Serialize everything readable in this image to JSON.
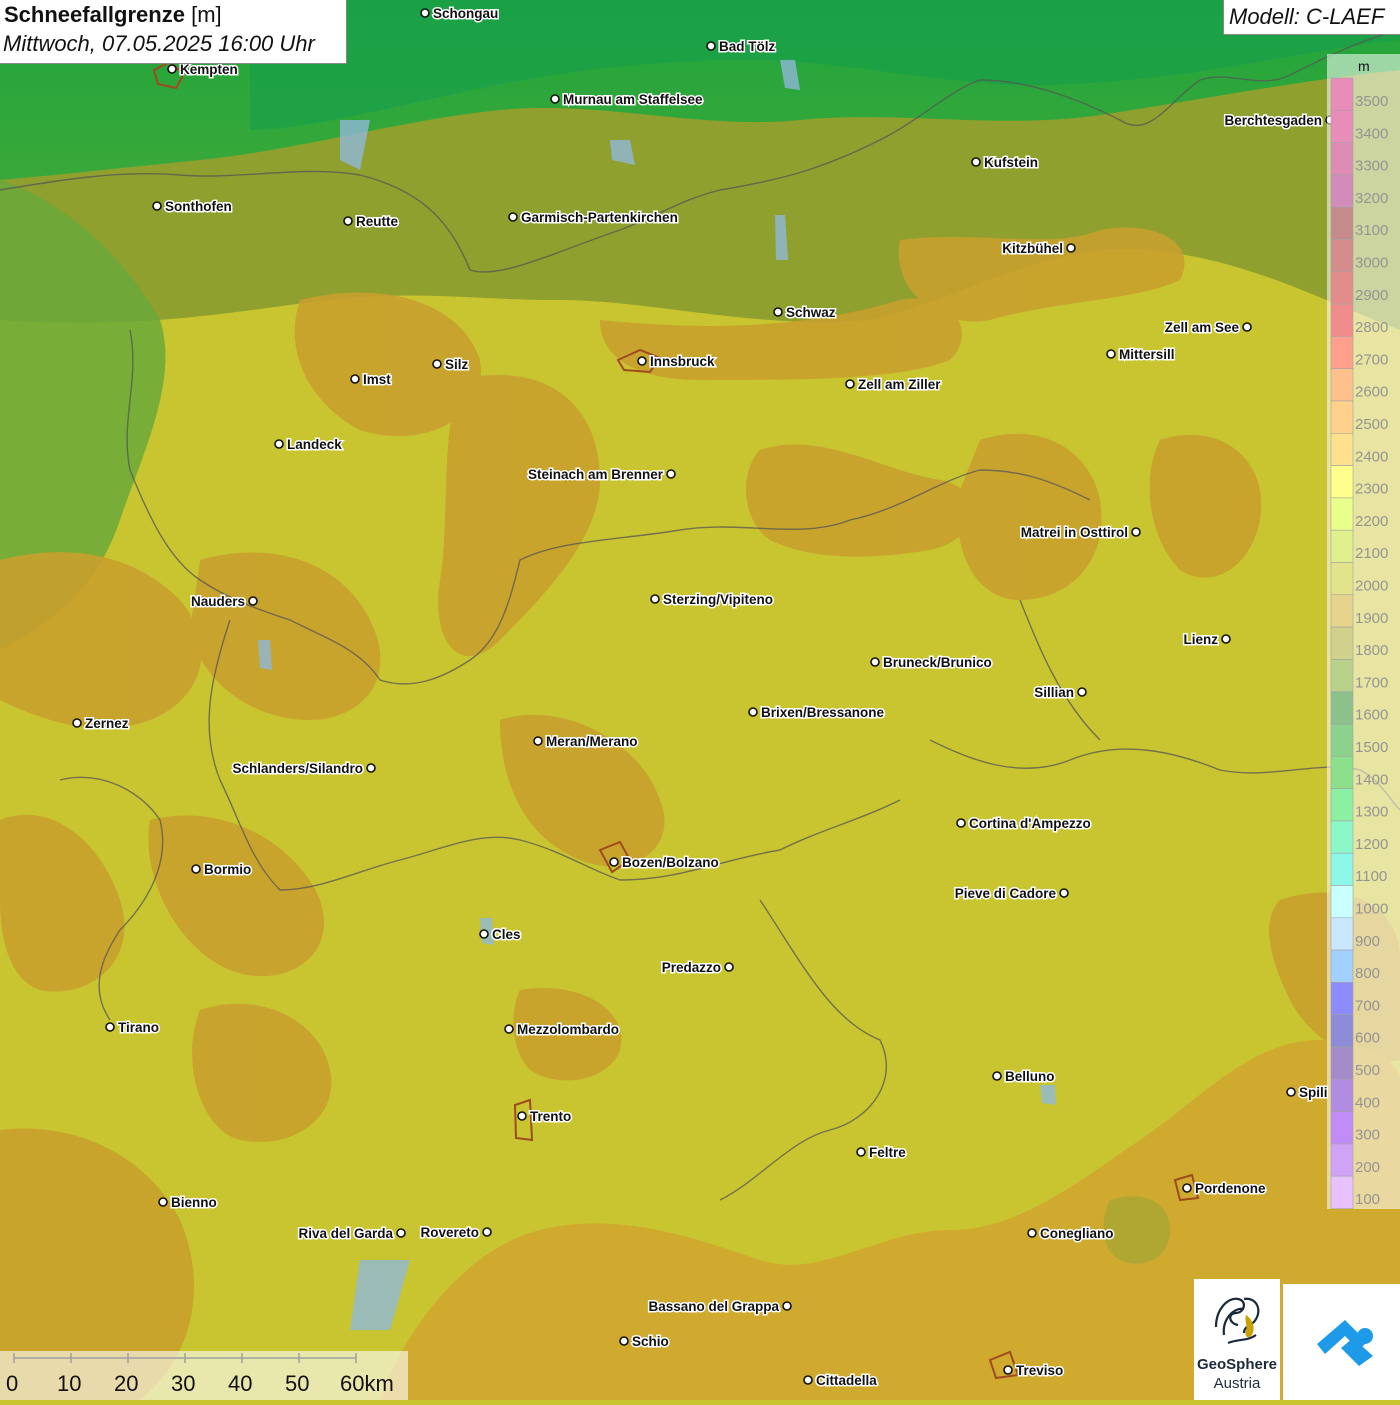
{
  "header": {
    "title": "Schneefallgrenze",
    "unit": "[m]",
    "datetime": "Mittwoch, 07.05.2025 16:00 Uhr"
  },
  "model": {
    "label": "Modell: C-LAEF"
  },
  "legend": {
    "unit": "m",
    "levels": [
      {
        "value": "3500",
        "color": "#cc0066"
      },
      {
        "value": "3400",
        "color": "#cc0066"
      },
      {
        "value": "3300",
        "color": "#b8005c"
      },
      {
        "value": "3200",
        "color": "#990066"
      },
      {
        "value": "3100",
        "color": "#800000"
      },
      {
        "value": "3000",
        "color": "#a00000"
      },
      {
        "value": "2900",
        "color": "#c00000"
      },
      {
        "value": "2800",
        "color": "#e00000"
      },
      {
        "value": "2700",
        "color": "#ff2a00"
      },
      {
        "value": "2600",
        "color": "#ff7700"
      },
      {
        "value": "2500",
        "color": "#ff9900"
      },
      {
        "value": "2400",
        "color": "#ffbb00"
      },
      {
        "value": "2300",
        "color": "#ffff00"
      },
      {
        "value": "2200",
        "color": "#ccff00"
      },
      {
        "value": "2100",
        "color": "#bbdd00"
      },
      {
        "value": "2000",
        "color": "#c2c200"
      },
      {
        "value": "1900",
        "color": "#c9a000"
      },
      {
        "value": "1800",
        "color": "#999900"
      },
      {
        "value": "1700",
        "color": "#669900"
      },
      {
        "value": "1600",
        "color": "#007700"
      },
      {
        "value": "1500",
        "color": "#009900"
      },
      {
        "value": "1400",
        "color": "#00bb00"
      },
      {
        "value": "1300",
        "color": "#00dd33"
      },
      {
        "value": "1200",
        "color": "#00ee88"
      },
      {
        "value": "1100",
        "color": "#00eecc"
      },
      {
        "value": "1000",
        "color": "#88ffff"
      },
      {
        "value": "900",
        "color": "#88ccff"
      },
      {
        "value": "800",
        "color": "#3399ff"
      },
      {
        "value": "700",
        "color": "#0000ff"
      },
      {
        "value": "600",
        "color": "#0000aa"
      },
      {
        "value": "500",
        "color": "#330088"
      },
      {
        "value": "400",
        "color": "#5500bb"
      },
      {
        "value": "300",
        "color": "#7700ee"
      },
      {
        "value": "200",
        "color": "#9933ee"
      },
      {
        "value": "100",
        "color": "#cc77ff"
      }
    ]
  },
  "scale": {
    "labels": [
      "0",
      "10",
      "20",
      "30",
      "40",
      "50",
      "60km"
    ]
  },
  "cities": [
    {
      "name": "Schongau"
    },
    {
      "name": "Bad Tölz"
    },
    {
      "name": "Kempten"
    },
    {
      "name": "Murnau am Staffelsee"
    },
    {
      "name": "Berchtesgaden"
    },
    {
      "name": "Kufstein"
    },
    {
      "name": "Sonthofen"
    },
    {
      "name": "Reutte"
    },
    {
      "name": "Garmisch-Partenkirchen"
    },
    {
      "name": "Kitzbühel"
    },
    {
      "name": "Schwaz"
    },
    {
      "name": "Zell am See"
    },
    {
      "name": "Mittersill"
    },
    {
      "name": "Innsbruck"
    },
    {
      "name": "Silz"
    },
    {
      "name": "Imst"
    },
    {
      "name": "Zell am Ziller"
    },
    {
      "name": "Landeck"
    },
    {
      "name": "Steinach am Brenner"
    },
    {
      "name": "Matrei in Osttirol"
    },
    {
      "name": "Nauders"
    },
    {
      "name": "Sterzing/Vipiteno"
    },
    {
      "name": "Lienz"
    },
    {
      "name": "Bruneck/Brunico"
    },
    {
      "name": "Sillian"
    },
    {
      "name": "Zernez"
    },
    {
      "name": "Brixen/Bressanone"
    },
    {
      "name": "Meran/Merano"
    },
    {
      "name": "Schlanders/Silandro"
    },
    {
      "name": "Cortina d'Ampezzo"
    },
    {
      "name": "Bozen/Bolzano"
    },
    {
      "name": "Bormio"
    },
    {
      "name": "Pieve di Cadore"
    },
    {
      "name": "Cles"
    },
    {
      "name": "Predazzo"
    },
    {
      "name": "Tirano"
    },
    {
      "name": "Mezzolombardo"
    },
    {
      "name": "Belluno"
    },
    {
      "name": "Spili"
    },
    {
      "name": "Trento"
    },
    {
      "name": "Feltre"
    },
    {
      "name": "Pordenone"
    },
    {
      "name": "Bienno"
    },
    {
      "name": "Riva del Garda"
    },
    {
      "name": "Rovereto"
    },
    {
      "name": "Conegliano"
    },
    {
      "name": "Bassano del Grappa"
    },
    {
      "name": "Schio"
    },
    {
      "name": "Treviso"
    },
    {
      "name": "Cittadella"
    }
  ],
  "logos": {
    "geosphere_line1": "GeoSphere",
    "geosphere_line2": "Austria"
  },
  "colors": {
    "lowland_green": "#3aa83a",
    "mid_olive": "#8fa02e",
    "base_yellow": "#c9c530",
    "orange_patch": "#c8a02e"
  }
}
